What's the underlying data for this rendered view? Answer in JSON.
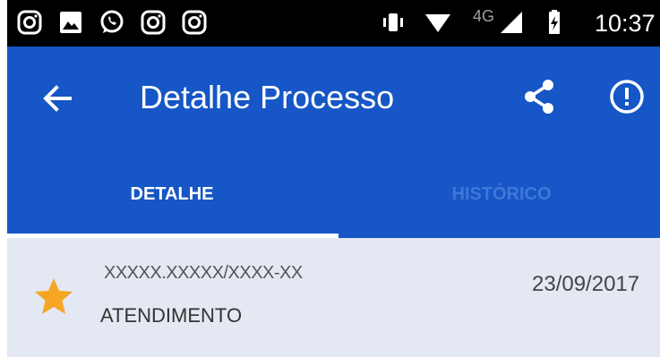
{
  "status_bar": {
    "left_icons": [
      "instagram-icon",
      "image-icon",
      "whatsapp-icon",
      "instagram-icon",
      "instagram-icon"
    ],
    "network_label": "4G",
    "time": "10:37"
  },
  "app_bar": {
    "title": "Detalhe Processo",
    "back_icon": "arrow-back-icon",
    "actions": [
      "share-icon",
      "info-icon"
    ],
    "color": "#1656c6"
  },
  "tabs": [
    {
      "label": "DETALHE",
      "selected": true
    },
    {
      "label": "HISTÓRICO",
      "selected": false
    }
  ],
  "process": {
    "number": "XXXXX.XXXXX/XXXX-XX",
    "type": "ATENDIMENTO",
    "date": "23/09/2017",
    "starred": true,
    "star_color": "#f5a623"
  }
}
